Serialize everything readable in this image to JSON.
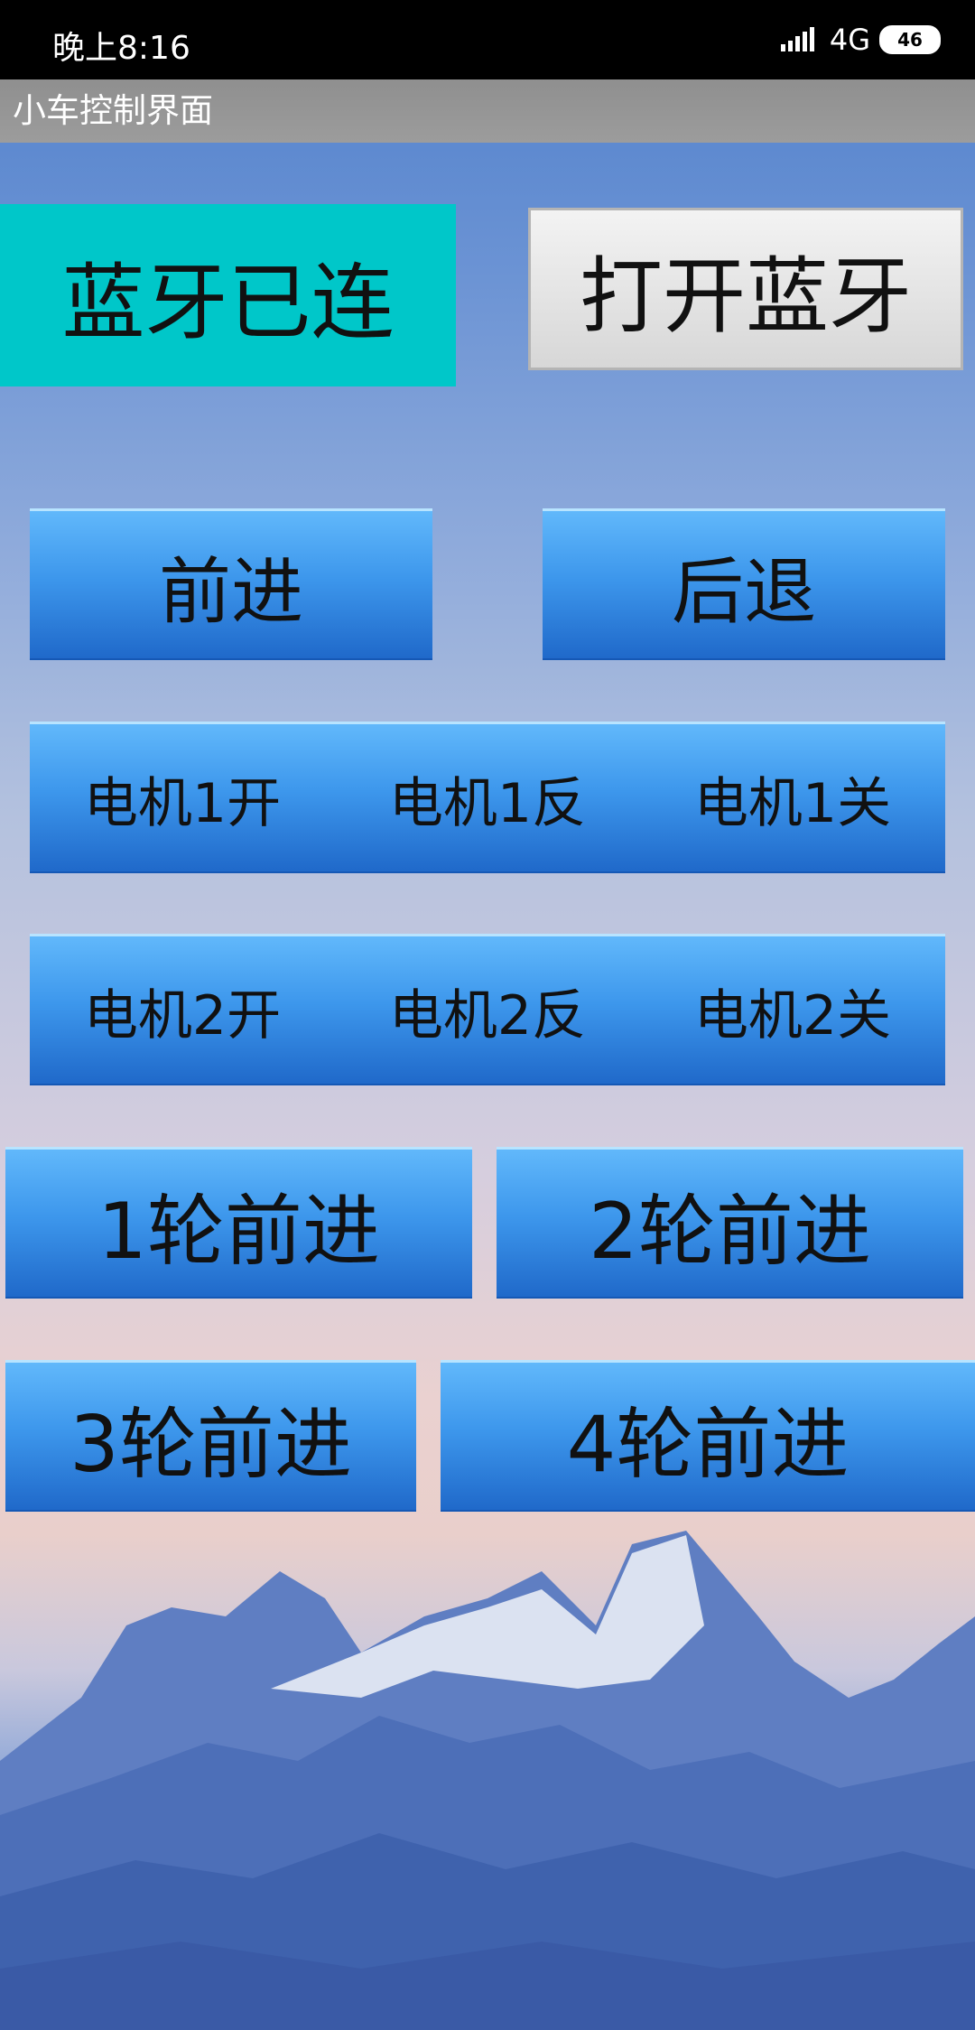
{
  "status_bar": {
    "time": "晚上8:16",
    "network": "4G",
    "battery": "46"
  },
  "app_bar": {
    "title": "小车控制界面"
  },
  "bluetooth": {
    "status_label": "蓝牙已连",
    "open_label": "打开蓝牙"
  },
  "drive": {
    "forward": "前进",
    "backward": "后退"
  },
  "motor1": {
    "on": "电机1开",
    "reverse": "电机1反",
    "off": "电机1关"
  },
  "motor2": {
    "on": "电机2开",
    "reverse": "电机2反",
    "off": "电机2关"
  },
  "wheels": {
    "w1": "1轮前进",
    "w2": "2轮前进",
    "w3": "3轮前进",
    "w4": "4轮前进"
  },
  "colors": {
    "accent_teal": "#00c7c9",
    "button_blue": "#3d97ec",
    "appbar_gray": "#999999"
  }
}
